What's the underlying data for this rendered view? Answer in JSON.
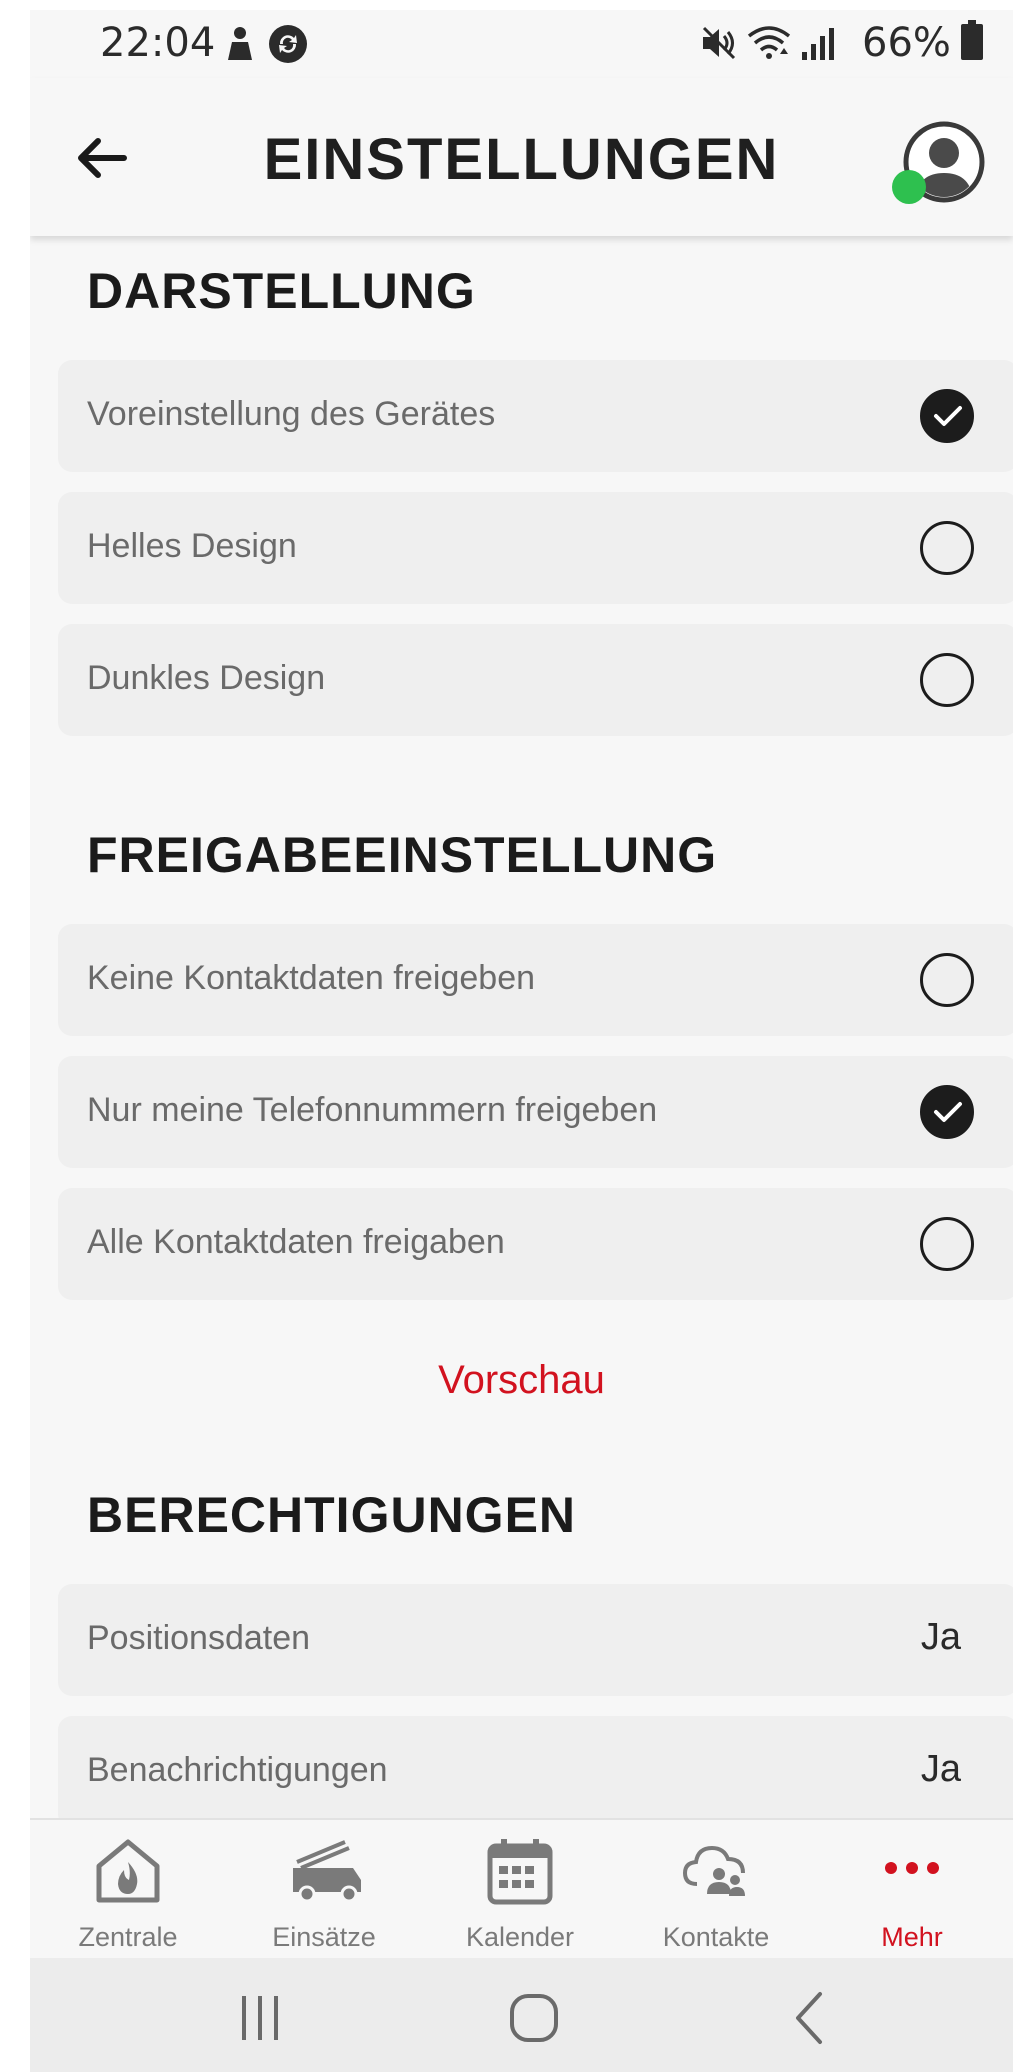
{
  "status_bar": {
    "time": "22:04",
    "battery": "66%",
    "icons": [
      "notification-person-icon",
      "sync-icon",
      "mute-icon",
      "wifi-icon",
      "signal-icon",
      "battery-icon"
    ]
  },
  "app_bar": {
    "title": "EINSTELLUNGEN",
    "back_icon": "arrow-left-icon",
    "avatar_icon": "user-avatar-icon",
    "online_color": "#2ec04f"
  },
  "sections": {
    "display": {
      "title": "DARSTELLUNG",
      "options": [
        {
          "label": "Voreinstellung des Gerätes",
          "selected": true
        },
        {
          "label": "Helles Design",
          "selected": false
        },
        {
          "label": "Dunkles Design",
          "selected": false
        }
      ]
    },
    "sharing": {
      "title": "FREIGABEEINSTELLUNG",
      "options": [
        {
          "label": "Keine Kontaktdaten freigeben",
          "selected": false
        },
        {
          "label": "Nur meine Telefonnummern freigeben",
          "selected": true
        },
        {
          "label": "Alle Kontaktdaten freigaben",
          "selected": false
        }
      ],
      "preview_link": "Vorschau"
    },
    "permissions": {
      "title": "BERECHTIGUNGEN",
      "items": [
        {
          "label": "Positionsdaten",
          "value": "Ja"
        },
        {
          "label": "Benachrichtigungen",
          "value": "Ja"
        }
      ]
    }
  },
  "bottom_nav": {
    "items": [
      {
        "label": "Zentrale",
        "icon": "fire-station-icon",
        "active": false
      },
      {
        "label": "Einsätze",
        "icon": "fire-truck-icon",
        "active": false
      },
      {
        "label": "Kalender",
        "icon": "calendar-icon",
        "active": false
      },
      {
        "label": "Kontakte",
        "icon": "cloud-contacts-icon",
        "active": false
      },
      {
        "label": "Mehr",
        "icon": "more-dots-icon",
        "active": true
      }
    ]
  },
  "system_nav": {
    "icons": [
      "recent-apps-icon",
      "home-icon",
      "back-icon"
    ]
  },
  "colors": {
    "accent": "#d2121f",
    "background": "#f7f7f7",
    "row_background": "#efefef",
    "text_dark": "#1b1b1b",
    "text_muted": "#6a6a6a",
    "inactive_nav": "#7a7a7a"
  }
}
